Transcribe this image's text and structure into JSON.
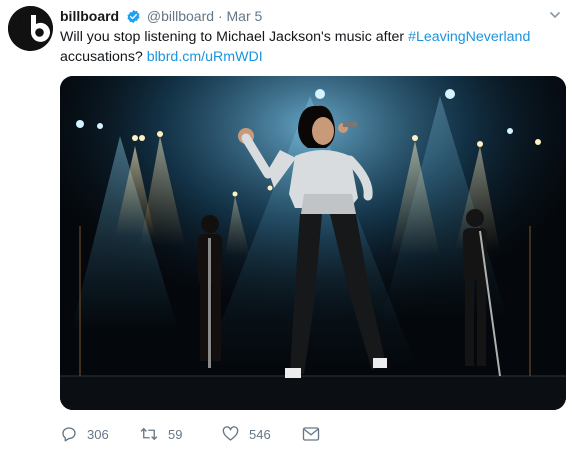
{
  "tweet": {
    "display_name": "billboard",
    "handle": "@billboard",
    "separator": "·",
    "date": "Mar 5",
    "text_before": "Will you stop listening to Michael Jackson's music after ",
    "hashtag": "#LeavingNeverland",
    "text_middle": " accusations? ",
    "link": "blbrd.cm/uRmWDI",
    "avatar_logo_text": "billboard"
  },
  "actions": {
    "reply_count": "306",
    "retweet_count": "59",
    "like_count": "546"
  },
  "colors": {
    "link": "#1b95e0",
    "verified": "#1da1f2",
    "muted": "#657786"
  },
  "icons": [
    "billboard-logo-icon",
    "verified-badge-icon",
    "caret-down-icon",
    "reply-icon",
    "retweet-icon",
    "like-icon",
    "direct-message-icon"
  ]
}
